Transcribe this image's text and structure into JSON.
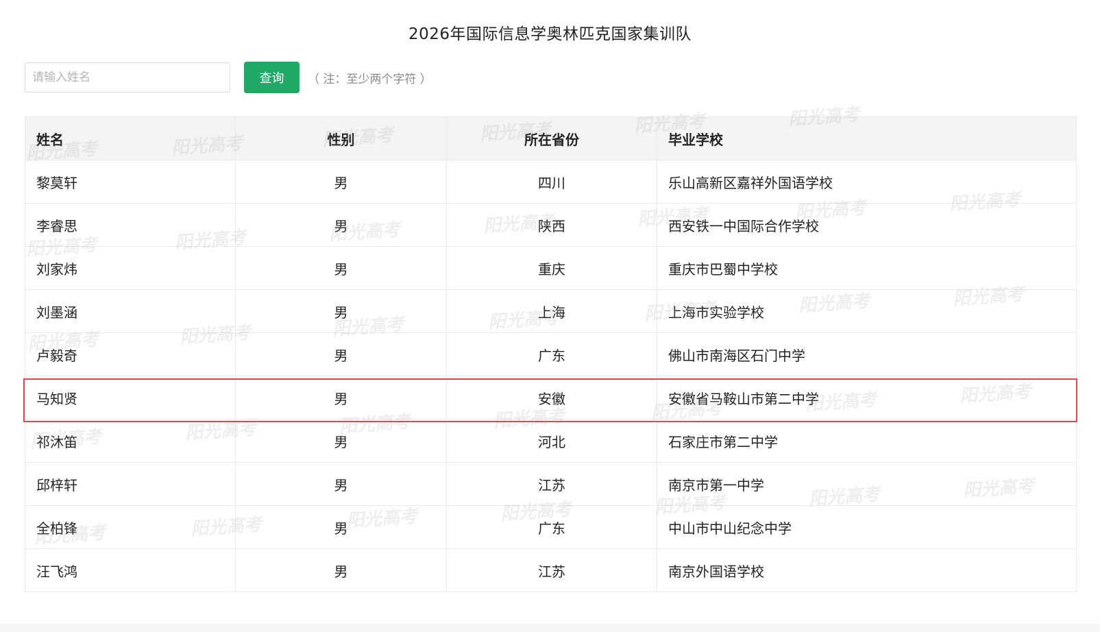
{
  "page": {
    "title": "2026年国际信息学奥林匹克国家集训队"
  },
  "search": {
    "placeholder": "请输入姓名",
    "button_label": "查询",
    "note": "（ 注：至少两个字符 ）"
  },
  "table": {
    "headers": {
      "name": "姓名",
      "gender": "性别",
      "province": "所在省份",
      "school": "毕业学校"
    },
    "rows": [
      {
        "name": "黎莫轩",
        "gender": "男",
        "province": "四川",
        "school": "乐山高新区嘉祥外国语学校"
      },
      {
        "name": "李睿思",
        "gender": "男",
        "province": "陕西",
        "school": "西安铁一中国际合作学校"
      },
      {
        "name": "刘家炜",
        "gender": "男",
        "province": "重庆",
        "school": "重庆市巴蜀中学校"
      },
      {
        "name": "刘墨涵",
        "gender": "男",
        "province": "上海",
        "school": "上海市实验学校"
      },
      {
        "name": "卢毅奇",
        "gender": "男",
        "province": "广东",
        "school": "佛山市南海区石门中学"
      },
      {
        "name": "马知贤",
        "gender": "男",
        "province": "安徽",
        "school": "安徽省马鞍山市第二中学"
      },
      {
        "name": "祁沐笛",
        "gender": "男",
        "province": "河北",
        "school": "石家庄市第二中学"
      },
      {
        "name": "邱梓轩",
        "gender": "男",
        "province": "江苏",
        "school": "南京市第一中学"
      },
      {
        "name": "全柏锋",
        "gender": "男",
        "province": "广东",
        "school": "中山市中山纪念中学"
      },
      {
        "name": "汪飞鸿",
        "gender": "男",
        "province": "江苏",
        "school": "南京外国语学校"
      }
    ],
    "highlighted_row_index": 5
  },
  "watermark": {
    "text": "阳光高考"
  },
  "colors": {
    "button_green": "#1fa866",
    "highlight_red": "#e04848",
    "header_bg": "#f4f4f4",
    "border": "#eaeaea"
  }
}
